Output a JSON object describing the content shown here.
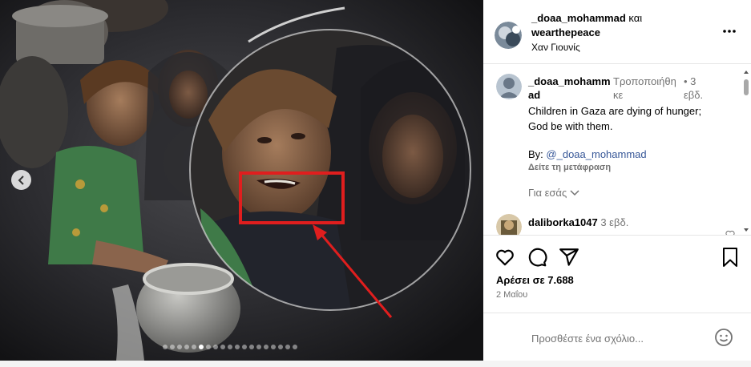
{
  "post": {
    "author": "_doaa_mohammad",
    "conjunction": "και",
    "coauthor": "wearthepeace",
    "location": "Χαν Γιουνίς"
  },
  "caption": {
    "user_line1": "_doaa_mohamm",
    "user_line2": "ad",
    "edited_line1": "Τροποποιήθη",
    "edited_line2": "κε",
    "time_line1": "• 3",
    "time_line2": "εβδ.",
    "text": "Children in Gaza are dying of hunger; God be with them.",
    "by_label": "By:",
    "by_handle": "@_doaa_mohammad",
    "translate": "Δείτε τη μετάφραση",
    "more_likes": "Για εσάς"
  },
  "comment2": {
    "user": "daliborka1047",
    "time": "3 εβδ."
  },
  "stats": {
    "likes": "Αρέσει σε 7.688",
    "date": "2 Μαΐου"
  },
  "composer": {
    "placeholder": "Προσθέστε ένα σχόλιο..."
  },
  "carousel": {
    "dot_count": 19,
    "active_index": 5
  },
  "icons": [
    "chevron-left-icon",
    "more-icon",
    "heart-icon",
    "comment-icon",
    "share-icon",
    "bookmark-icon",
    "emoji-icon",
    "chevron-down-icon"
  ],
  "colors": {
    "link": "#385898",
    "muted": "#737373",
    "highlight": "#e01e1e"
  }
}
